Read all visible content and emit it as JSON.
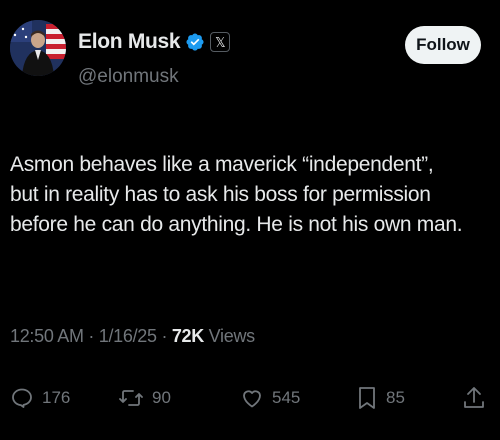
{
  "author": {
    "display_name": "Elon Musk",
    "handle": "@elonmusk",
    "affiliation_badge": "𝕏",
    "verified_color": "#1d9bf0"
  },
  "follow_button": {
    "label": "Follow"
  },
  "tweet": {
    "lines": [
      "Asmon behaves like a maverick “independent”,",
      "but in reality has to ask his boss for permission",
      "before he can do anything. He is not his own man."
    ]
  },
  "meta": {
    "time": "12:50 AM",
    "separator": "·",
    "date": "1/16/25",
    "views_count": "72K",
    "views_label": "Views"
  },
  "actions": {
    "replies": "176",
    "reposts": "90",
    "likes": "545",
    "bookmarks": "85"
  },
  "colors": {
    "background": "#000000",
    "text": "#e7e9ea",
    "secondary": "#71767b",
    "button_bg": "#eff3f4"
  }
}
